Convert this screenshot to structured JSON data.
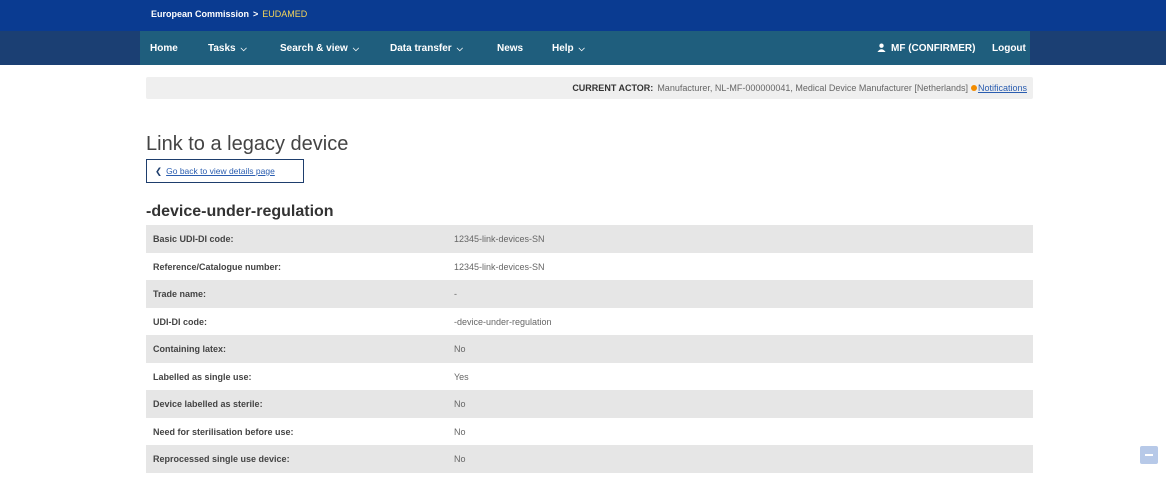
{
  "header": {
    "org": "European Commission",
    "separator": ">",
    "app": "EUDAMED"
  },
  "nav": {
    "home": "Home",
    "tasks": "Tasks",
    "search_view": "Search & view",
    "data_transfer": "Data transfer",
    "news": "News",
    "help": "Help",
    "user": "MF (CONFIRMER)",
    "logout": "Logout"
  },
  "actor": {
    "label": "CURRENT ACTOR:",
    "value": "Manufacturer, NL-MF-000000041, Medical Device Manufacturer [Netherlands]",
    "notifications": "Notifications"
  },
  "page": {
    "title": "Link to a legacy device",
    "back_label": "Go back to view details page",
    "device_heading": "-device-under-regulation"
  },
  "details": [
    {
      "label": "Basic UDI-DI code:",
      "value": "12345-link-devices-SN"
    },
    {
      "label": "Reference/Catalogue number:",
      "value": "12345-link-devices-SN"
    },
    {
      "label": "Trade name:",
      "value": "-"
    },
    {
      "label": "UDI-DI code:",
      "value": "-device-under-regulation"
    },
    {
      "label": "Containing latex:",
      "value": "No"
    },
    {
      "label": "Labelled as single use:",
      "value": "Yes"
    },
    {
      "label": "Device labelled as sterile:",
      "value": "No"
    },
    {
      "label": "Need for sterilisation before use:",
      "value": "No"
    },
    {
      "label": "Reprocessed single use device:",
      "value": "No"
    }
  ],
  "icons": {
    "user": "user-icon",
    "back": "chevron-left-icon",
    "caret": "chevron-down-icon",
    "notification": "dot-icon",
    "scroll": "scroll-to-top-icon"
  },
  "colors": {
    "top_strip": "#0a3b91",
    "nav_bar": "#1f5e7d",
    "accent_link": "#2a5db0",
    "notification_dot": "#f28c00",
    "row_shade": "#e6e6e6"
  }
}
